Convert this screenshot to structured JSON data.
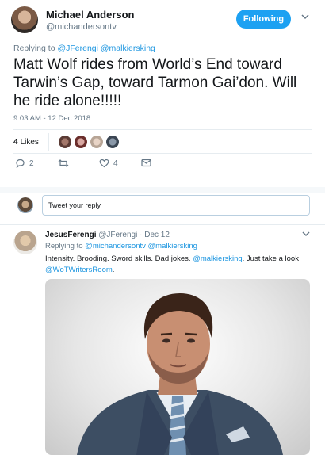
{
  "main_tweet": {
    "author_name": "Michael Anderson",
    "author_handle": "@michandersontv",
    "follow_label": "Following",
    "replying_prefix": "Replying to",
    "replying_to": [
      "@JFerengi",
      "@malkiersking"
    ],
    "text": "Matt Wolf rides from World’s End toward Tarwin’s Gap, toward Tarmon Gai’don. Will he ride alone!!!!!",
    "timestamp": "9:03 AM - 12 Dec 2018",
    "likes_count": "4",
    "likes_label": "Likes",
    "actions": {
      "replies": "2",
      "retweets": "",
      "likes": "4"
    }
  },
  "composer": {
    "placeholder": "Tweet your reply"
  },
  "reply_tweet": {
    "author_name": "JesusFerengi",
    "author_handle": "@JFerengi",
    "date": "Dec 12",
    "separator": "·",
    "replying_prefix": "Replying to",
    "replying_to": [
      "@michandersontv",
      "@malkiersking"
    ],
    "body_part1": "Intensity. Brooding. Sword skills. Dad jokes. ",
    "body_mention1": "@malkiersking",
    "body_part2": ". Just take a look ",
    "body_mention2": "@WoTWritersRoom",
    "body_part3": "."
  },
  "colors": {
    "accent": "#1da1f2",
    "link": "#1b95e0",
    "muted": "#657786",
    "divider": "#e6ecf0"
  },
  "icons": [
    "reply-icon",
    "retweet-icon",
    "heart-icon",
    "dm-icon",
    "chevron-down-icon"
  ]
}
